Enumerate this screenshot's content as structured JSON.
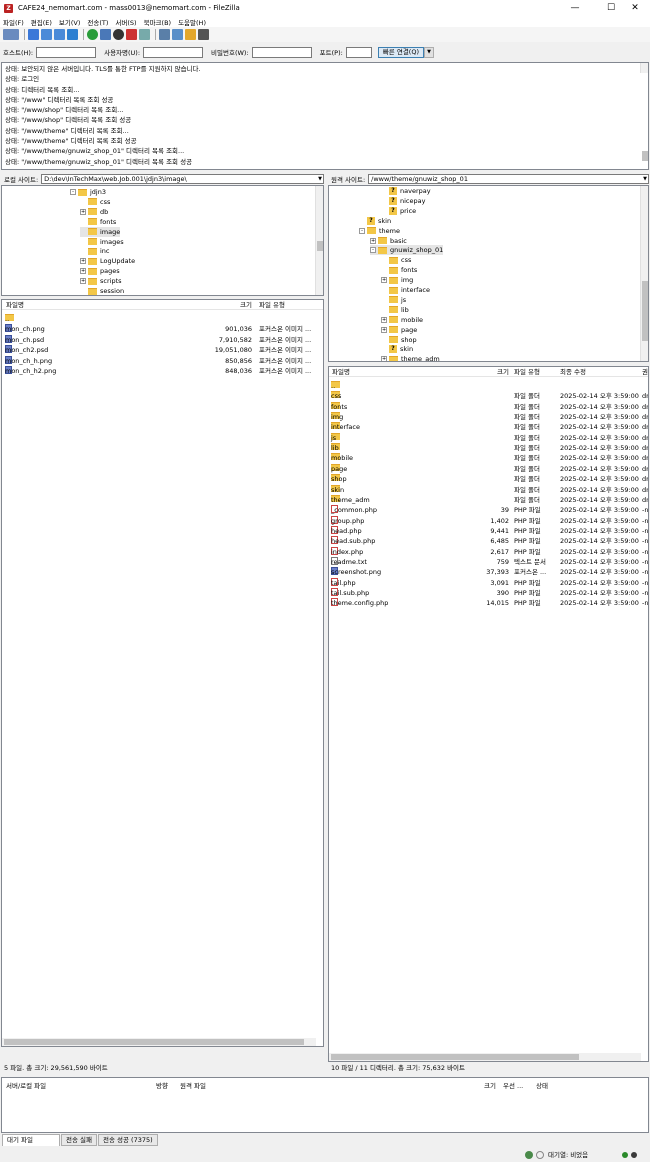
{
  "window": {
    "title": "CAFE24_nemomart.com - mass0013@nemomart.com - FileZilla",
    "minimize": "—",
    "maximize": "☐",
    "close": "✕"
  },
  "menu": [
    "파일(F)",
    "편집(E)",
    "보기(V)",
    "전송(T)",
    "서버(S)",
    "북마크(B)",
    "도움말(H)"
  ],
  "connect": {
    "host_label": "호스트(H):",
    "user_label": "사용자명(U):",
    "pass_label": "비밀번호(W):",
    "port_label": "포트(P):",
    "quickconnect": "빠른 연결(Q)",
    "host": "",
    "user": "",
    "pass": "",
    "port": ""
  },
  "log": [
    "상태: 보안되지 않은 서버입니다. TLS를 통한 FTP를 지원하지 않습니다.",
    "상태: 로그인",
    "상태: 디렉터리 목록 조회...",
    "상태: \"/www\" 디렉터리 목록 조회 성공",
    "상태: \"/www/shop\" 디렉터리 목록 조회...",
    "상태: \"/www/shop\" 디렉터리 목록 조회 성공",
    "상태: \"/www/theme\" 디렉터리 목록 조회...",
    "상태: \"/www/theme\" 디렉터리 목록 조회 성공",
    "상태: \"/www/theme/gnuwiz_shop_01\" 디렉터리 목록 조회...",
    "상태: \"/www/theme/gnuwiz_shop_01\" 디렉터리 목록 조회 성공"
  ],
  "local": {
    "site_label": "로컬 사이트:",
    "path": "D:\\dev\\InTechMax\\web.Job.001\\jdjn3\\image\\",
    "tree": [
      {
        "name": "jdjn3",
        "exp": "-",
        "level": 0
      },
      {
        "name": "css",
        "exp": "",
        "level": 1
      },
      {
        "name": "db",
        "exp": "+",
        "level": 1
      },
      {
        "name": "fonts",
        "exp": "",
        "level": 1
      },
      {
        "name": "image",
        "exp": "",
        "level": 1,
        "sel": true
      },
      {
        "name": "images",
        "exp": "",
        "level": 1
      },
      {
        "name": "inc",
        "exp": "",
        "level": 1
      },
      {
        "name": "LogUpdate",
        "exp": "+",
        "level": 1
      },
      {
        "name": "pages",
        "exp": "+",
        "level": 1
      },
      {
        "name": "scripts",
        "exp": "+",
        "level": 1
      },
      {
        "name": "session",
        "exp": "",
        "level": 1
      }
    ],
    "cols": {
      "name": "파일명",
      "size": "크기",
      "type": "파일 유형"
    },
    "files": [
      {
        "name": "..",
        "size": "",
        "type": "",
        "ico": "folder"
      },
      {
        "name": "mon_ch.png",
        "size": "901,036",
        "type": "포커스온 이미지 ...",
        "ico": "png"
      },
      {
        "name": "mon_ch.psd",
        "size": "7,910,582",
        "type": "포커스온 이미지 ...",
        "ico": "png"
      },
      {
        "name": "mon_ch2.psd",
        "size": "19,051,080",
        "type": "포커스온 이미지 ...",
        "ico": "png"
      },
      {
        "name": "mon_ch_h.png",
        "size": "850,856",
        "type": "포커스온 이미지 ...",
        "ico": "png"
      },
      {
        "name": "mon_ch_h2.png",
        "size": "848,036",
        "type": "포커스온 이미지 ...",
        "ico": "png"
      }
    ],
    "status": "5 파일. 총 크기: 29,561,590 바이트"
  },
  "remote": {
    "site_label": "원격 사이트:",
    "path": "/www/theme/gnuwiz_shop_01",
    "tree": [
      {
        "name": "naverpay",
        "exp": "",
        "level": 2,
        "q": true
      },
      {
        "name": "nicepay",
        "exp": "",
        "level": 2,
        "q": true
      },
      {
        "name": "price",
        "exp": "",
        "level": 2,
        "q": true
      },
      {
        "name": "skin",
        "exp": "",
        "level": 0,
        "q": true
      },
      {
        "name": "theme",
        "exp": "-",
        "level": 0
      },
      {
        "name": "basic",
        "exp": "+",
        "level": 1
      },
      {
        "name": "gnuwiz_shop_01",
        "exp": "-",
        "level": 1,
        "sel": true
      },
      {
        "name": "css",
        "exp": "",
        "level": 2
      },
      {
        "name": "fonts",
        "exp": "",
        "level": 2
      },
      {
        "name": "img",
        "exp": "+",
        "level": 2
      },
      {
        "name": "interface",
        "exp": "",
        "level": 2
      },
      {
        "name": "js",
        "exp": "",
        "level": 2
      },
      {
        "name": "lib",
        "exp": "",
        "level": 2
      },
      {
        "name": "mobile",
        "exp": "+",
        "level": 2
      },
      {
        "name": "page",
        "exp": "+",
        "level": 2
      },
      {
        "name": "shop",
        "exp": "",
        "level": 2
      },
      {
        "name": "skin",
        "exp": "",
        "level": 2,
        "q": true
      },
      {
        "name": "theme_adm",
        "exp": "+",
        "level": 2
      }
    ],
    "cols": {
      "name": "파일명",
      "size": "크기",
      "type": "파일 유형",
      "modified": "최종 수정",
      "perm": "권"
    },
    "files": [
      {
        "name": "..",
        "size": "",
        "type": "",
        "mod": "",
        "perm": "",
        "ico": "folder"
      },
      {
        "name": "css",
        "size": "",
        "type": "파일 폴더",
        "mod": "2025-02-14 오후 3:59:00",
        "perm": "dr",
        "ico": "folder"
      },
      {
        "name": "fonts",
        "size": "",
        "type": "파일 폴더",
        "mod": "2025-02-14 오후 3:59:00",
        "perm": "dr",
        "ico": "folder"
      },
      {
        "name": "img",
        "size": "",
        "type": "파일 폴더",
        "mod": "2025-02-14 오후 3:59:00",
        "perm": "dr",
        "ico": "folder"
      },
      {
        "name": "interface",
        "size": "",
        "type": "파일 폴더",
        "mod": "2025-02-14 오후 3:59:00",
        "perm": "dr",
        "ico": "folder"
      },
      {
        "name": "js",
        "size": "",
        "type": "파일 폴더",
        "mod": "2025-02-14 오후 3:59:00",
        "perm": "dr",
        "ico": "folder"
      },
      {
        "name": "lib",
        "size": "",
        "type": "파일 폴더",
        "mod": "2025-02-14 오후 3:59:00",
        "perm": "dr",
        "ico": "folder"
      },
      {
        "name": "mobile",
        "size": "",
        "type": "파일 폴더",
        "mod": "2025-02-14 오후 3:59:00",
        "perm": "dr",
        "ico": "folder"
      },
      {
        "name": "page",
        "size": "",
        "type": "파일 폴더",
        "mod": "2025-02-14 오후 3:59:00",
        "perm": "dr",
        "ico": "folder"
      },
      {
        "name": "shop",
        "size": "",
        "type": "파일 폴더",
        "mod": "2025-02-14 오후 3:59:00",
        "perm": "dr",
        "ico": "folder"
      },
      {
        "name": "skin",
        "size": "",
        "type": "파일 폴더",
        "mod": "2025-02-14 오후 3:59:00",
        "perm": "dr",
        "ico": "folder"
      },
      {
        "name": "theme_adm",
        "size": "",
        "type": "파일 폴더",
        "mod": "2025-02-14 오후 3:59:00",
        "perm": "dr",
        "ico": "folder"
      },
      {
        "name": "_common.php",
        "size": "39",
        "type": "PHP 파일",
        "mod": "2025-02-14 오후 3:59:00",
        "perm": "-n",
        "ico": "php"
      },
      {
        "name": "group.php",
        "size": "1,402",
        "type": "PHP 파일",
        "mod": "2025-02-14 오후 3:59:00",
        "perm": "-n",
        "ico": "php"
      },
      {
        "name": "head.php",
        "size": "9,441",
        "type": "PHP 파일",
        "mod": "2025-02-14 오후 3:59:00",
        "perm": "-n",
        "ico": "php"
      },
      {
        "name": "head.sub.php",
        "size": "6,485",
        "type": "PHP 파일",
        "mod": "2025-02-14 오후 3:59:00",
        "perm": "-n",
        "ico": "php"
      },
      {
        "name": "index.php",
        "size": "2,617",
        "type": "PHP 파일",
        "mod": "2025-02-14 오후 3:59:00",
        "perm": "-n",
        "ico": "php"
      },
      {
        "name": "readme.txt",
        "size": "759",
        "type": "텍스트 문서",
        "mod": "2025-02-14 오후 3:59:00",
        "perm": "-n",
        "ico": "txt"
      },
      {
        "name": "screenshot.png",
        "size": "37,393",
        "type": "포커스온 ...",
        "mod": "2025-02-14 오후 3:59:00",
        "perm": "-n",
        "ico": "png"
      },
      {
        "name": "tail.php",
        "size": "3,091",
        "type": "PHP 파일",
        "mod": "2025-02-14 오후 3:59:00",
        "perm": "-n",
        "ico": "php"
      },
      {
        "name": "tail.sub.php",
        "size": "390",
        "type": "PHP 파일",
        "mod": "2025-02-14 오후 3:59:00",
        "perm": "-n",
        "ico": "php"
      },
      {
        "name": "theme.config.php",
        "size": "14,015",
        "type": "PHP 파일",
        "mod": "2025-02-14 오후 3:59:00",
        "perm": "-n",
        "ico": "php"
      }
    ],
    "status": "10 파일 / 11 디렉터리. 총 크기: 75,632 바이트"
  },
  "queue": {
    "cols": {
      "server": "서버/로컬 파일",
      "direction": "방향",
      "remote": "원격 파일",
      "size": "크기",
      "priority": "우선 ...",
      "status": "상태"
    },
    "tabs": [
      "대기 파일",
      "전송 실패",
      "전송 성공 (7375)"
    ]
  },
  "statusbar": {
    "queue": "대기열: 비었음"
  },
  "colors": {
    "folder": "#f3c747",
    "accent": "#3c7fb1"
  }
}
